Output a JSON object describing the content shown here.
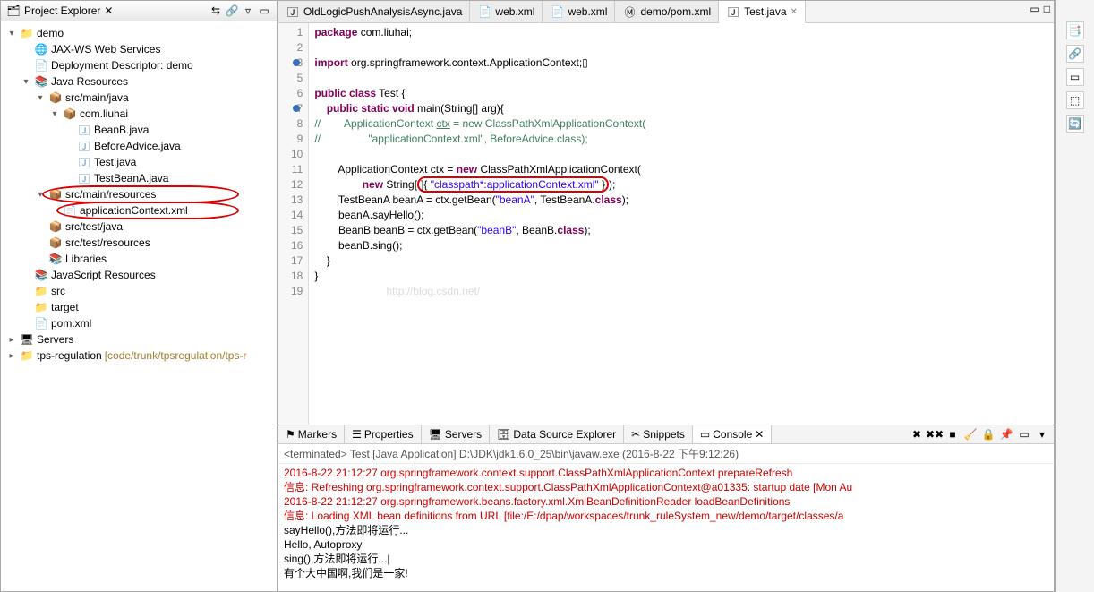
{
  "explorer": {
    "title": "Project Explorer",
    "items": [
      {
        "indent": 0,
        "exp": "▾",
        "icon": "📁",
        "cls": "icon-project",
        "label": "demo",
        "name": "project-demo"
      },
      {
        "indent": 1,
        "exp": "",
        "icon": "🌐",
        "cls": "",
        "label": "JAX-WS Web Services",
        "name": "jaxws-node"
      },
      {
        "indent": 1,
        "exp": "",
        "icon": "📄",
        "cls": "",
        "label": "Deployment Descriptor: demo",
        "name": "deployment-descriptor"
      },
      {
        "indent": 1,
        "exp": "▾",
        "icon": "📚",
        "cls": "",
        "label": "Java Resources",
        "name": "java-resources"
      },
      {
        "indent": 2,
        "exp": "▾",
        "icon": "📦",
        "cls": "icon-package",
        "label": "src/main/java",
        "name": "src-main-java"
      },
      {
        "indent": 3,
        "exp": "▾",
        "icon": "📦",
        "cls": "icon-package",
        "label": "com.liuhai",
        "name": "package-com-liuhai"
      },
      {
        "indent": 4,
        "exp": "",
        "icon": "🄹",
        "cls": "icon-java",
        "label": "BeanB.java",
        "name": "file-beanb"
      },
      {
        "indent": 4,
        "exp": "",
        "icon": "🄹",
        "cls": "icon-java",
        "label": "BeforeAdvice.java",
        "name": "file-beforeadvice"
      },
      {
        "indent": 4,
        "exp": "",
        "icon": "🄹",
        "cls": "icon-java",
        "label": "Test.java",
        "name": "file-test"
      },
      {
        "indent": 4,
        "exp": "",
        "icon": "🄹",
        "cls": "icon-java",
        "label": "TestBeanA.java",
        "name": "file-testbeana"
      },
      {
        "indent": 2,
        "exp": "▾",
        "icon": "📦",
        "cls": "icon-package",
        "label": "src/main/resources",
        "name": "src-main-resources",
        "circled": true
      },
      {
        "indent": 3,
        "exp": "",
        "icon": "📄",
        "cls": "icon-xml",
        "label": "applicationContext.xml",
        "name": "file-appcontext",
        "circled": true
      },
      {
        "indent": 2,
        "exp": "",
        "icon": "📦",
        "cls": "icon-package",
        "label": "src/test/java",
        "name": "src-test-java"
      },
      {
        "indent": 2,
        "exp": "",
        "icon": "📦",
        "cls": "icon-package",
        "label": "src/test/resources",
        "name": "src-test-resources"
      },
      {
        "indent": 2,
        "exp": "",
        "icon": "📚",
        "cls": "icon-lib",
        "label": "Libraries",
        "name": "libraries"
      },
      {
        "indent": 1,
        "exp": "",
        "icon": "📚",
        "cls": "",
        "label": "JavaScript Resources",
        "name": "js-resources"
      },
      {
        "indent": 1,
        "exp": "",
        "icon": "📁",
        "cls": "icon-folder",
        "label": "src",
        "name": "folder-src"
      },
      {
        "indent": 1,
        "exp": "",
        "icon": "📁",
        "cls": "icon-folder",
        "label": "target",
        "name": "folder-target"
      },
      {
        "indent": 1,
        "exp": "",
        "icon": "📄",
        "cls": "icon-xml",
        "label": "pom.xml",
        "name": "file-pom"
      },
      {
        "indent": 0,
        "exp": "▸",
        "icon": "🖥",
        "cls": "",
        "label": "Servers",
        "name": "servers-node"
      },
      {
        "indent": 0,
        "exp": "▸",
        "icon": "📁",
        "cls": "icon-project",
        "label": "tps-regulation",
        "suffix": " [code/trunk/tpsregulation/tps-r",
        "name": "project-tps"
      }
    ]
  },
  "editor": {
    "tabs": [
      {
        "icon": "🄹",
        "label": "OldLogicPushAnalysisAsync.java",
        "active": false
      },
      {
        "icon": "📄",
        "label": "web.xml",
        "active": false
      },
      {
        "icon": "📄",
        "label": "web.xml",
        "active": false
      },
      {
        "icon": "Ⓜ",
        "label": "demo/pom.xml",
        "active": false
      },
      {
        "icon": "🄹",
        "label": "Test.java",
        "active": true
      }
    ],
    "lines": [
      {
        "n": 1,
        "html": "<span class='kw'>package</span> com.liuhai;"
      },
      {
        "n": 2,
        "html": ""
      },
      {
        "n": 3,
        "bp": true,
        "html": "<span class='kw'>import</span> org.springframework.context.ApplicationContext;▯"
      },
      {
        "n": 5,
        "html": ""
      },
      {
        "n": 6,
        "html": "<span class='kw'>public class</span> Test {"
      },
      {
        "n": 7,
        "bp": true,
        "html": "    <span class='kw'>public static void</span> main(String[] arg){"
      },
      {
        "n": 8,
        "html": "<span class='cmnt'>//        ApplicationContext <u>ctx</u> = new ClassPathXmlApplicationContext(</span>"
      },
      {
        "n": 9,
        "html": "<span class='cmnt'>//                \"applicationContext.xml\", BeforeAdvice.class);</span>"
      },
      {
        "n": 10,
        "html": ""
      },
      {
        "n": 11,
        "html": "        ApplicationContext ctx = <span class='kw'>new</span> ClassPathXmlApplicationContext("
      },
      {
        "n": 12,
        "html": "                <span class='kw'>new</span> String[<span class='red-oval'>]{ <span class='str'>\"classpath*:applicationContext.xml\"</span> }</span>);"
      },
      {
        "n": 13,
        "html": "        TestBeanA beanA = ctx.getBean(<span class='str'>\"beanA\"</span>, TestBeanA.<span class='kw'>class</span>);"
      },
      {
        "n": 14,
        "html": "        beanA.sayHello();"
      },
      {
        "n": 15,
        "html": "        BeanB beanB = ctx.getBean(<span class='str'>\"beanB\"</span>, BeanB.<span class='kw'>class</span>);"
      },
      {
        "n": 16,
        "html": "        beanB.sing();"
      },
      {
        "n": 17,
        "html": "    }"
      },
      {
        "n": 18,
        "html": "}"
      },
      {
        "n": 19,
        "html": "                        <span class='watermark'>http://blog.csdn.net/</span>"
      }
    ]
  },
  "bottom": {
    "tabs": [
      {
        "icon": "⚑",
        "label": "Markers"
      },
      {
        "icon": "☰",
        "label": "Properties"
      },
      {
        "icon": "🖥",
        "label": "Servers"
      },
      {
        "icon": "🗄",
        "label": "Data Source Explorer"
      },
      {
        "icon": "✂",
        "label": "Snippets"
      },
      {
        "icon": "▭",
        "label": "Console",
        "active": true
      }
    ],
    "header": "<terminated> Test [Java Application] D:\\JDK\\jdk1.6.0_25\\bin\\javaw.exe (2016-8-22 下午9:12:26)",
    "lines": [
      {
        "cls": "err",
        "text": "2016-8-22 21:12:27 org.springframework.context.support.ClassPathXmlApplicationContext prepareRefresh"
      },
      {
        "cls": "err",
        "text": "信息: Refreshing org.springframework.context.support.ClassPathXmlApplicationContext@a01335: startup date [Mon Au"
      },
      {
        "cls": "err",
        "text": "2016-8-22 21:12:27 org.springframework.beans.factory.xml.XmlBeanDefinitionReader loadBeanDefinitions"
      },
      {
        "cls": "err",
        "text": "信息: Loading XML bean definitions from URL [file:/E:/dpap/workspaces/trunk_ruleSystem_new/demo/target/classes/a"
      },
      {
        "cls": "",
        "text": "sayHello(),方法即将运行..."
      },
      {
        "cls": "",
        "text": "Hello, Autoproxy"
      },
      {
        "cls": "",
        "text": "sing(),方法即将运行...|"
      },
      {
        "cls": "",
        "text": "有个大中国啊,我们是一家!"
      }
    ]
  },
  "rightStrip": [
    "📑",
    "🔗",
    "▭",
    "⬚",
    "🔄"
  ]
}
